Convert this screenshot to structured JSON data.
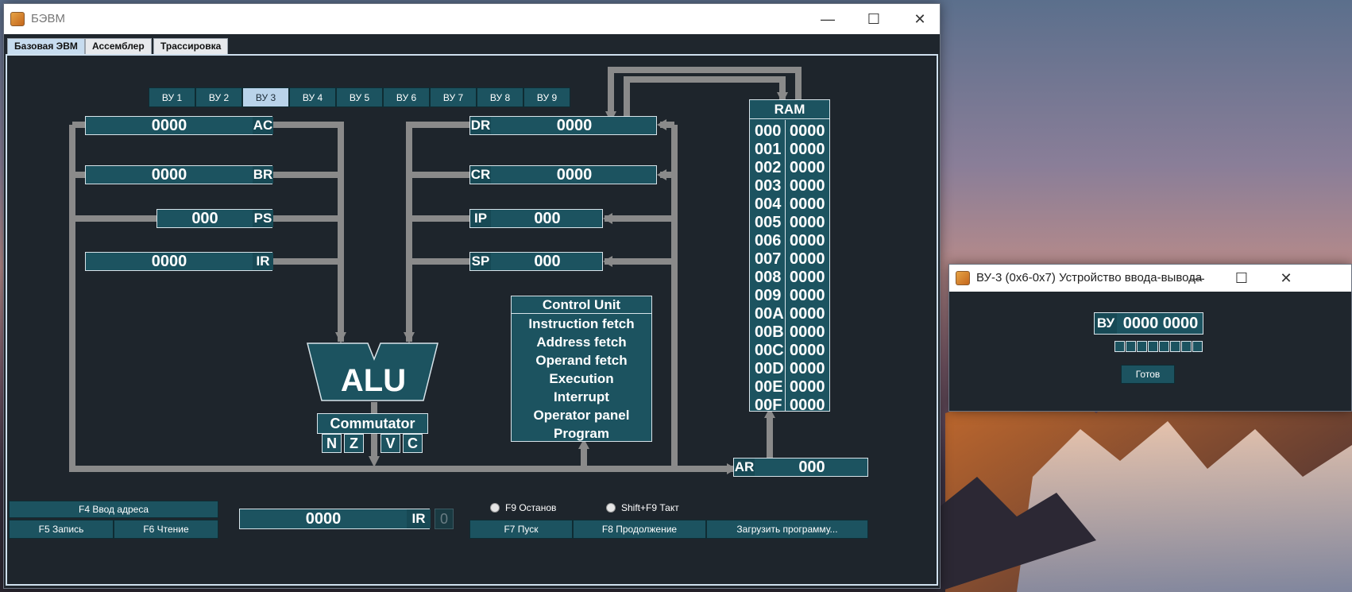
{
  "main_window": {
    "title": "БЭВМ",
    "controls": {
      "minimize": "—",
      "maximize": "☐",
      "close": "✕"
    }
  },
  "tabs": [
    "Базовая ЭВМ",
    "Ассемблер",
    "Трассировка"
  ],
  "active_tab": "Базовая ЭВМ",
  "vu_tabs": [
    "ВУ 1",
    "ВУ 2",
    "ВУ 3",
    "ВУ 4",
    "ВУ 5",
    "ВУ 6",
    "ВУ 7",
    "ВУ 8",
    "ВУ 9"
  ],
  "active_vu": "ВУ 3",
  "registers": {
    "ac": {
      "value": "0000",
      "label": "AC"
    },
    "br": {
      "value": "0000",
      "label": "BR"
    },
    "ps": {
      "value": "000",
      "label": "PS"
    },
    "ir": {
      "value": "0000",
      "label": "IR"
    },
    "dr": {
      "value": "0000",
      "label": "DR"
    },
    "cr": {
      "value": "0000",
      "label": "CR"
    },
    "ip": {
      "value": "000",
      "label": "IP"
    },
    "sp": {
      "value": "000",
      "label": "SP"
    },
    "ar": {
      "value": "000",
      "label": "AR"
    }
  },
  "ram": {
    "title": "RAM",
    "rows": [
      {
        "addr": "000",
        "value": "0000"
      },
      {
        "addr": "001",
        "value": "0000"
      },
      {
        "addr": "002",
        "value": "0000"
      },
      {
        "addr": "003",
        "value": "0000"
      },
      {
        "addr": "004",
        "value": "0000"
      },
      {
        "addr": "005",
        "value": "0000"
      },
      {
        "addr": "006",
        "value": "0000"
      },
      {
        "addr": "007",
        "value": "0000"
      },
      {
        "addr": "008",
        "value": "0000"
      },
      {
        "addr": "009",
        "value": "0000"
      },
      {
        "addr": "00A",
        "value": "0000"
      },
      {
        "addr": "00B",
        "value": "0000"
      },
      {
        "addr": "00C",
        "value": "0000"
      },
      {
        "addr": "00D",
        "value": "0000"
      },
      {
        "addr": "00E",
        "value": "0000"
      },
      {
        "addr": "00F",
        "value": "0000"
      }
    ]
  },
  "alu": {
    "label": "ALU"
  },
  "commutator": {
    "label": "Commutator"
  },
  "flags": [
    "N",
    "Z",
    "V",
    "C"
  ],
  "control_unit": {
    "title": "Control Unit",
    "items": [
      "Instruction fetch",
      "Address fetch",
      "Operand fetch",
      "Execution",
      "Interrupt",
      "Operator panel",
      "Program"
    ]
  },
  "bottom_panel": {
    "address_input": "F4 Ввод адреса",
    "write": "F5 Запись",
    "read": "F6 Чтение",
    "input_register": {
      "value": "0000",
      "label": "IR"
    },
    "bit_indicator": "0",
    "stop_radio": "F9 Останов",
    "step_radio": "Shift+F9 Такт",
    "start": "F7 Пуск",
    "continue": "F8 Продолжение",
    "load_program": "Загрузить программу..."
  },
  "io_window": {
    "title": "ВУ-3 (0x6-0x7) Устройство ввода-вывода",
    "register_label": "ВУ",
    "register_value": "0000 0000",
    "ready_button": "Готов",
    "bits": 8
  },
  "colors": {
    "panel_bg": "#1e252c",
    "register_fill": "#1c5360",
    "bus_gray": "#8a8a8a",
    "active_tab": "#c7dcef"
  }
}
